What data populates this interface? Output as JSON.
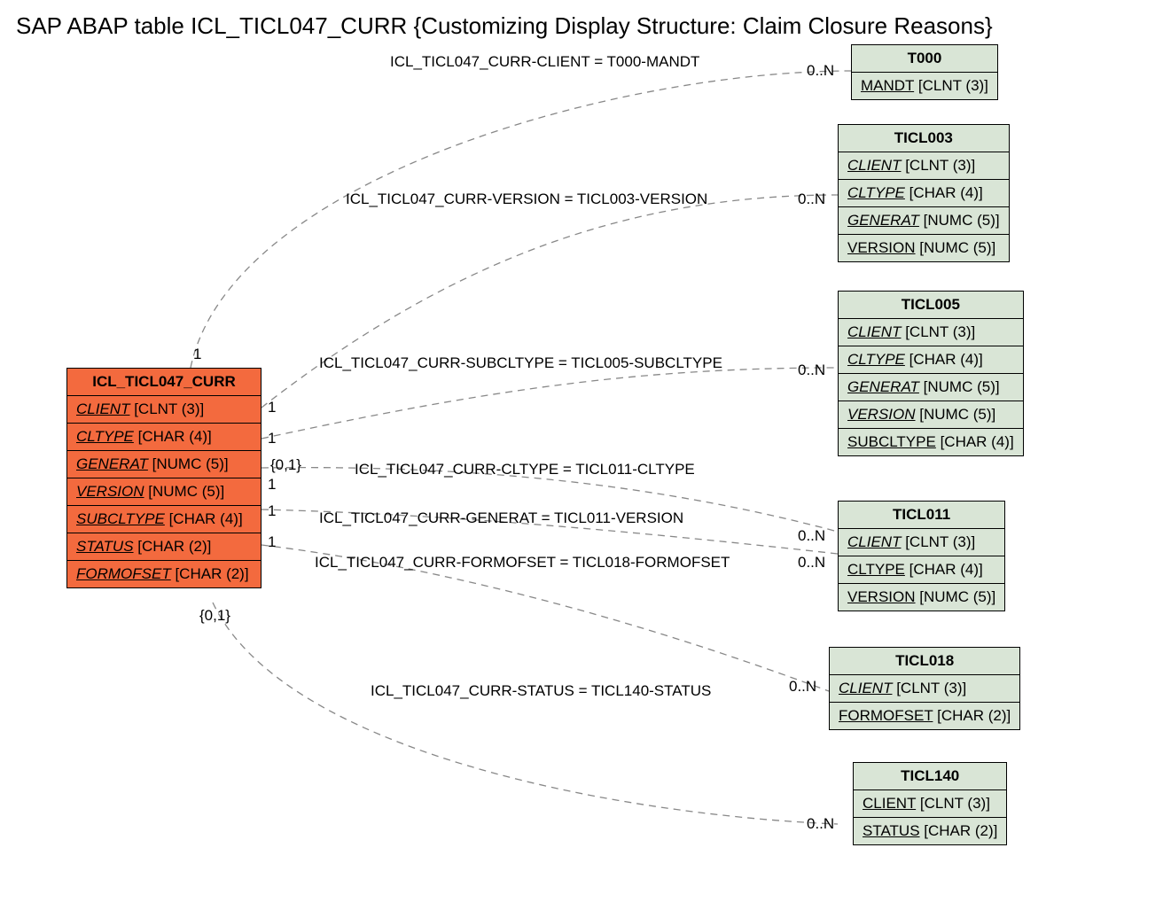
{
  "title": "SAP ABAP table ICL_TICL047_CURR {Customizing Display Structure: Claim Closure Reasons}",
  "main_entity": {
    "name": "ICL_TICL047_CURR",
    "fields": [
      {
        "name": "CLIENT",
        "type": "[CLNT (3)]",
        "style": "fk"
      },
      {
        "name": "CLTYPE",
        "type": "[CHAR (4)]",
        "style": "fk"
      },
      {
        "name": "GENERAT",
        "type": "[NUMC (5)]",
        "style": "fk"
      },
      {
        "name": "VERSION",
        "type": "[NUMC (5)]",
        "style": "fk"
      },
      {
        "name": "SUBCLTYPE",
        "type": "[CHAR (4)]",
        "style": "fk"
      },
      {
        "name": "STATUS",
        "type": "[CHAR (2)]",
        "style": "fk"
      },
      {
        "name": "FORMOFSET",
        "type": "[CHAR (2)]",
        "style": "fk"
      }
    ]
  },
  "entities": [
    {
      "name": "T000",
      "fields": [
        {
          "name": "MANDT",
          "type": "[CLNT (3)]",
          "style": "pk"
        }
      ]
    },
    {
      "name": "TICL003",
      "fields": [
        {
          "name": "CLIENT",
          "type": "[CLNT (3)]",
          "style": "fk"
        },
        {
          "name": "CLTYPE",
          "type": "[CHAR (4)]",
          "style": "fk"
        },
        {
          "name": "GENERAT",
          "type": "[NUMC (5)]",
          "style": "fk"
        },
        {
          "name": "VERSION",
          "type": "[NUMC (5)]",
          "style": "pk"
        }
      ]
    },
    {
      "name": "TICL005",
      "fields": [
        {
          "name": "CLIENT",
          "type": "[CLNT (3)]",
          "style": "fk"
        },
        {
          "name": "CLTYPE",
          "type": "[CHAR (4)]",
          "style": "fk"
        },
        {
          "name": "GENERAT",
          "type": "[NUMC (5)]",
          "style": "fk"
        },
        {
          "name": "VERSION",
          "type": "[NUMC (5)]",
          "style": "fk"
        },
        {
          "name": "SUBCLTYPE",
          "type": "[CHAR (4)]",
          "style": "pk"
        }
      ]
    },
    {
      "name": "TICL011",
      "fields": [
        {
          "name": "CLIENT",
          "type": "[CLNT (3)]",
          "style": "fk"
        },
        {
          "name": "CLTYPE",
          "type": "[CHAR (4)]",
          "style": "pk"
        },
        {
          "name": "VERSION",
          "type": "[NUMC (5)]",
          "style": "pk"
        }
      ]
    },
    {
      "name": "TICL018",
      "fields": [
        {
          "name": "CLIENT",
          "type": "[CLNT (3)]",
          "style": "fk"
        },
        {
          "name": "FORMOFSET",
          "type": "[CHAR (2)]",
          "style": "pk"
        }
      ]
    },
    {
      "name": "TICL140",
      "fields": [
        {
          "name": "CLIENT",
          "type": "[CLNT (3)]",
          "style": "pk"
        },
        {
          "name": "STATUS",
          "type": "[CHAR (2)]",
          "style": "pk"
        }
      ]
    }
  ],
  "edges": [
    {
      "label": "ICL_TICL047_CURR-CLIENT = T000-MANDT",
      "card_left": "1",
      "card_right": "0..N"
    },
    {
      "label": "ICL_TICL047_CURR-VERSION = TICL003-VERSION",
      "card_left": "1",
      "card_right": "0..N"
    },
    {
      "label": "ICL_TICL047_CURR-SUBCLTYPE = TICL005-SUBCLTYPE",
      "card_left": "1",
      "card_right": "0..N"
    },
    {
      "label": "ICL_TICL047_CURR-CLTYPE = TICL011-CLTYPE",
      "card_left": "{0,1}",
      "card_right": ""
    },
    {
      "label": "ICL_TICL047_CURR-GENERAT = TICL011-VERSION",
      "card_left": "1",
      "card_right": "0..N"
    },
    {
      "label": "ICL_TICL047_CURR-FORMOFSET = TICL018-FORMOFSET",
      "card_left": "1",
      "card_right": "0..N"
    },
    {
      "label": "ICL_TICL047_CURR-STATUS = TICL140-STATUS",
      "card_left": "{0,1}",
      "card_right": "0..N"
    }
  ]
}
